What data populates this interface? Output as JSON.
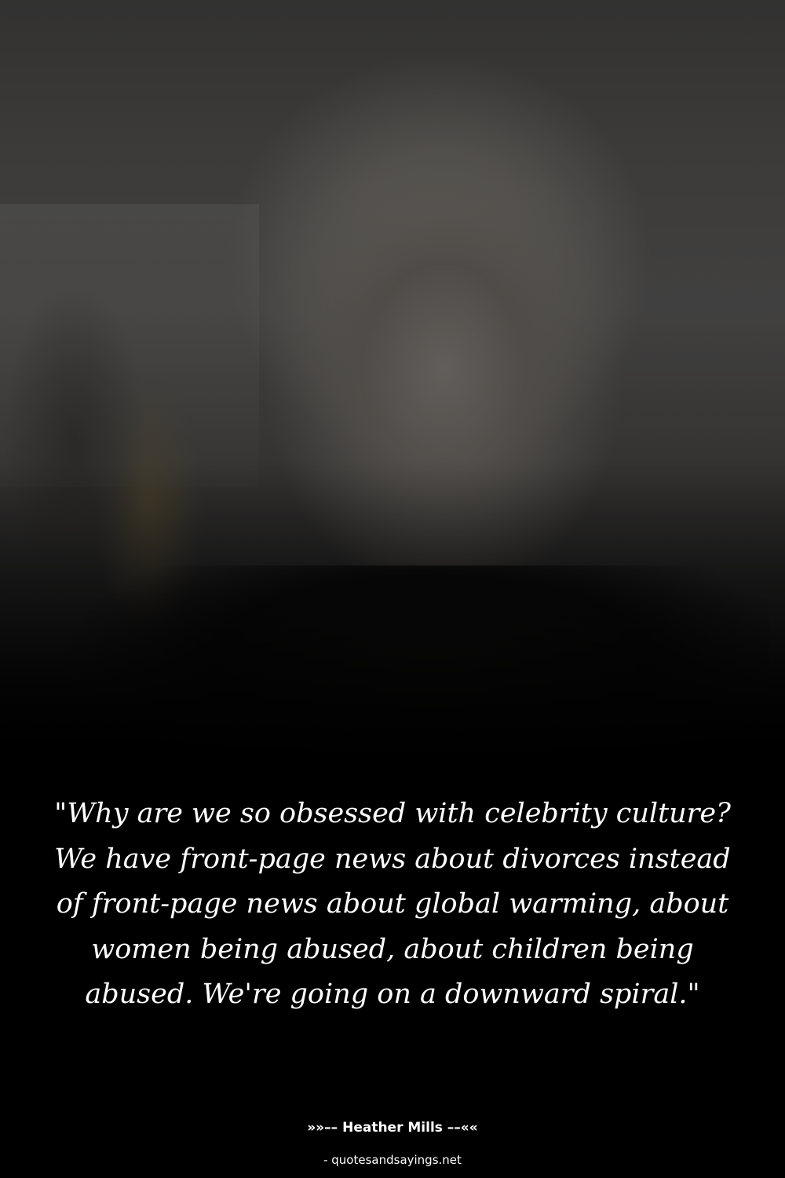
{
  "quote": {
    "text": "\"Why are we so obsessed with celebrity culture? We have front-page news about divorces instead of front-page news about global warming, about women being abused, about children being abused. We're going on a downward spiral.\""
  },
  "author": {
    "line": "»»–– Heather Mills ––««"
  },
  "source": {
    "line": "- quotesandsayings.net"
  },
  "colors": {
    "background": "#000000",
    "text": "#ffffff"
  }
}
